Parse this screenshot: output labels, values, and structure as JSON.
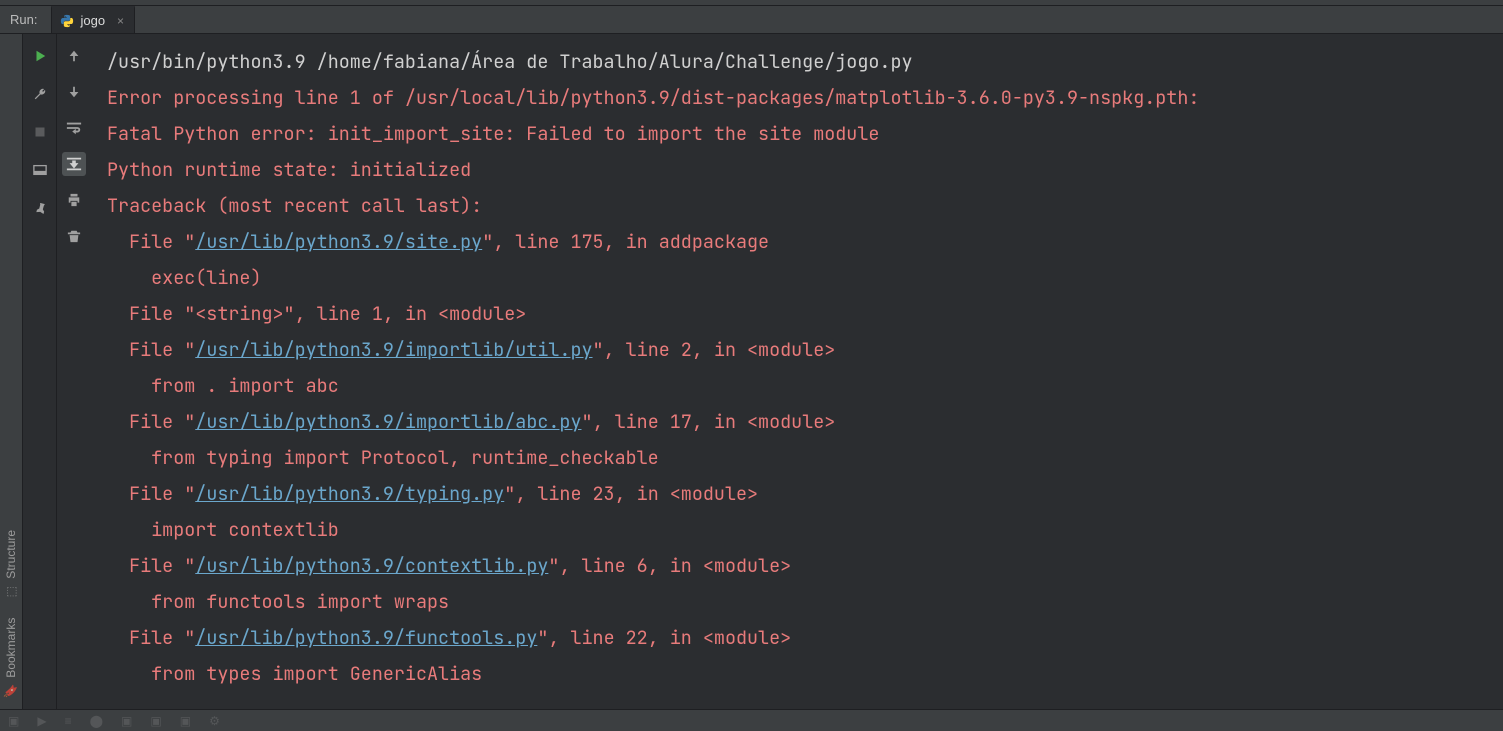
{
  "header": {
    "run_label": "Run:",
    "tab_title": "jogo",
    "tab_close": "×"
  },
  "sidebar_rail": {
    "structure": "Structure",
    "bookmarks": "Bookmarks"
  },
  "console": {
    "cmd": "/usr/bin/python3.9 /home/fabiana/Área de Trabalho/Alura/Challenge/jogo.py",
    "err_line": "Error processing line 1 of /usr/local/lib/python3.9/dist-packages/matplotlib-3.6.0-py3.9-nspkg.pth:",
    "blank": "",
    "fatal": "Fatal Python error: init_import_site: Failed to import the site module",
    "runtime": "Python runtime state: initialized",
    "traceback": "Traceback (most recent call last):",
    "tb": [
      {
        "pre": "  File \"",
        "link": "/usr/lib/python3.9/site.py",
        "post": "\", line 175, in addpackage"
      },
      {
        "indent": "    exec(line)"
      },
      {
        "plain": "  File \"<string>\", line 1, in <module>"
      },
      {
        "pre": "  File \"",
        "link": "/usr/lib/python3.9/importlib/util.py",
        "post": "\", line 2, in <module>"
      },
      {
        "indent": "    from . import abc"
      },
      {
        "pre": "  File \"",
        "link": "/usr/lib/python3.9/importlib/abc.py",
        "post": "\", line 17, in <module>"
      },
      {
        "indent": "    from typing import Protocol, runtime_checkable"
      },
      {
        "pre": "  File \"",
        "link": "/usr/lib/python3.9/typing.py",
        "post": "\", line 23, in <module>"
      },
      {
        "indent": "    import contextlib"
      },
      {
        "pre": "  File \"",
        "link": "/usr/lib/python3.9/contextlib.py",
        "post": "\", line 6, in <module>"
      },
      {
        "indent": "    from functools import wraps"
      },
      {
        "pre": "  File \"",
        "link": "/usr/lib/python3.9/functools.py",
        "post": "\", line 22, in <module>"
      },
      {
        "indent": "    from types import GenericAlias"
      }
    ]
  }
}
